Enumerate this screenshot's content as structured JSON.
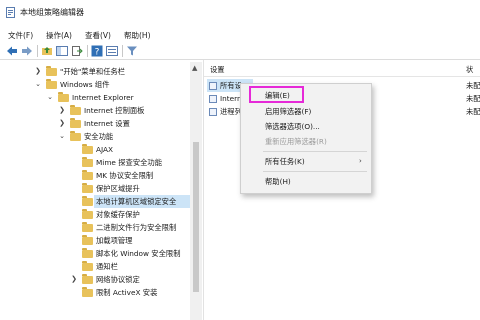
{
  "window": {
    "title": "本地组策略编辑器"
  },
  "menubar": {
    "items": [
      {
        "label": "文件(F)"
      },
      {
        "label": "操作(A)"
      },
      {
        "label": "查看(V)"
      },
      {
        "label": "帮助(H)"
      }
    ]
  },
  "toolbar": {
    "buttons": [
      "back-icon",
      "forward-icon",
      "folder-up-icon",
      "show-hide-tree-icon",
      "export-list-icon",
      "help-icon",
      "properties-icon",
      "filter-icon"
    ]
  },
  "tree": {
    "items": [
      {
        "label": "\"开始\"菜单和任务栏",
        "expanded": false
      },
      {
        "label": "Windows 组件",
        "expanded": true
      },
      {
        "label": "Internet Explorer",
        "expanded": true
      },
      {
        "label": "Internet 控制面板",
        "expanded": false
      },
      {
        "label": "Internet 设置",
        "expanded": false
      },
      {
        "label": "安全功能",
        "expanded": true
      },
      {
        "label": "AJAX"
      },
      {
        "label": "Mime 探查安全功能"
      },
      {
        "label": "MK 协议安全限制"
      },
      {
        "label": "保护区域提升"
      },
      {
        "label": "本地计算机区域锁定安全",
        "selected": true
      },
      {
        "label": "对象缓存保护"
      },
      {
        "label": "二进制文件行为安全限制"
      },
      {
        "label": "加载项管理"
      },
      {
        "label": "脚本化 Window 安全限制"
      },
      {
        "label": "通知栏"
      },
      {
        "label": "网络协议锁定",
        "expanded": false
      },
      {
        "label": "限制 ActiveX 安装"
      }
    ]
  },
  "list": {
    "columns": {
      "setting": "设置",
      "state": "状"
    },
    "rows": [
      {
        "label": "所有设",
        "state": "未配",
        "selected": true
      },
      {
        "label": "Intern",
        "state": "未配"
      },
      {
        "label": "进程列",
        "state": "未配"
      }
    ]
  },
  "context_menu": {
    "items": [
      {
        "label": "编辑(E)"
      },
      {
        "label": "启用筛选器(F)"
      },
      {
        "label": "筛选器选项(O)..."
      },
      {
        "label": "重新应用筛选器(R)",
        "disabled": true
      },
      {
        "label": "所有任务(K)",
        "submenu": true
      },
      {
        "label": "帮助(H)"
      }
    ]
  },
  "colors": {
    "highlight_border": "#e629d8",
    "selection": "#cce4f7",
    "folder": "#e8c25b"
  }
}
